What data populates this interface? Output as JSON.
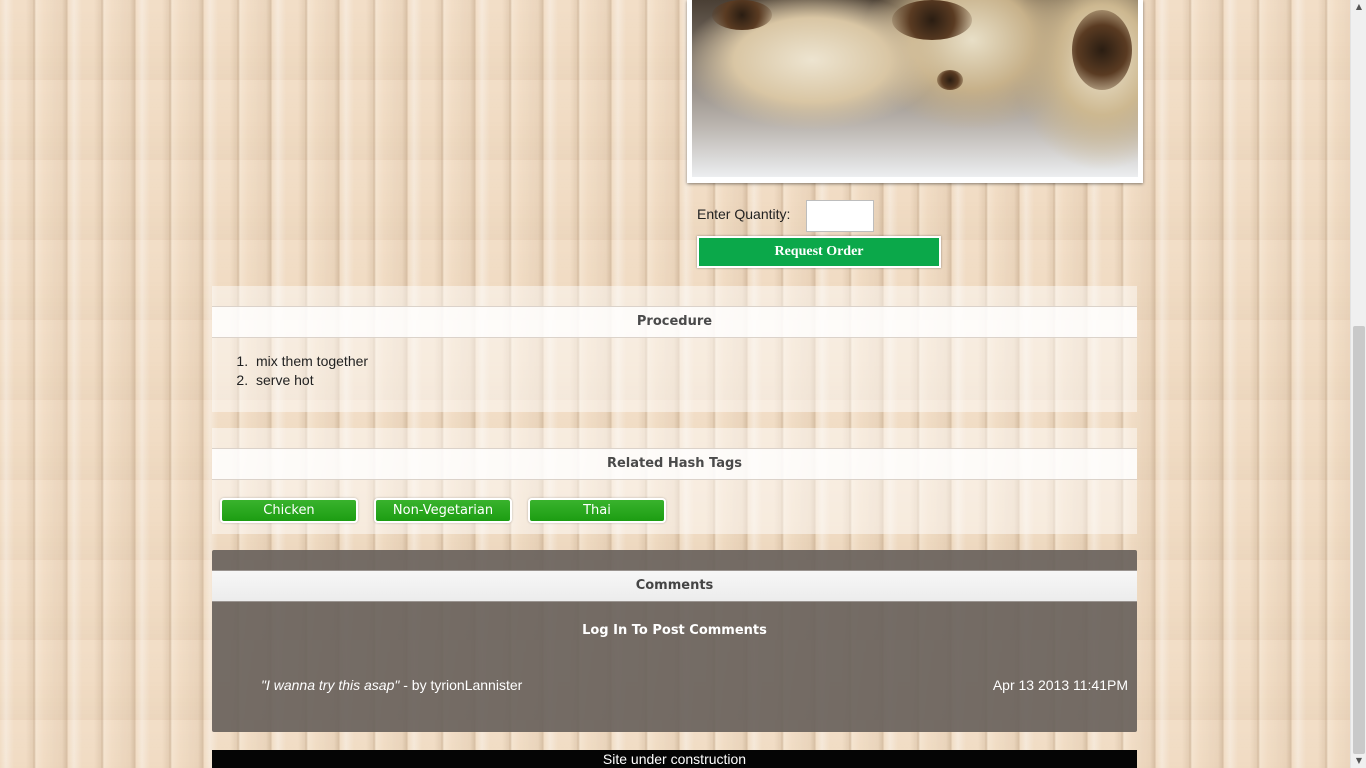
{
  "recipe_image": {
    "alt": "grilled chicken",
    "icon": "photo"
  },
  "order": {
    "quantity_label": "Enter Quantity:",
    "quantity_value": "",
    "button_label": "Request Order",
    "button_color": "#0ba84a"
  },
  "procedure": {
    "title": "Procedure",
    "steps": [
      "mix them together",
      "serve hot"
    ]
  },
  "hash_tags": {
    "title": "Related Hash Tags",
    "tags": [
      "Chicken",
      "Non-Vegetarian",
      "Thai"
    ],
    "tag_color": "#28a81e"
  },
  "comments": {
    "title": "Comments",
    "login_prompt": "Log In To Post Comments",
    "items": [
      {
        "text": "\"I wanna try this asap\"",
        "author": " - by tyrionLannister",
        "date": "Apr 13 2013 11:41PM"
      }
    ]
  },
  "footer": {
    "text": "Site under construction"
  }
}
